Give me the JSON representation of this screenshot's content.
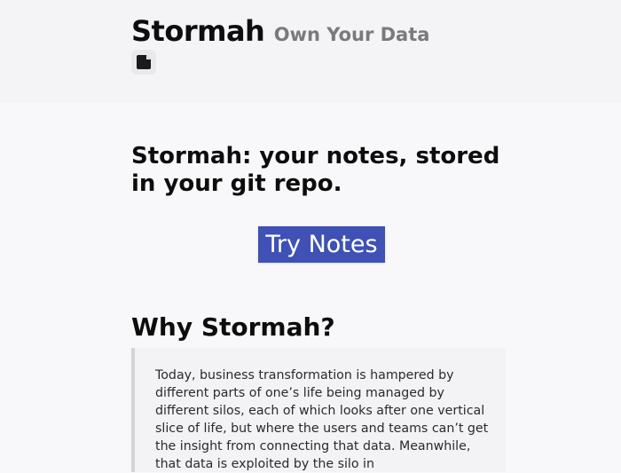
{
  "header": {
    "title": "Stormah",
    "tagline": "Own Your Data",
    "icon": "note-icon"
  },
  "hero": {
    "headline": "Stormah: your notes, stored in your git repo.",
    "cta_label": "Try Notes",
    "cta_color": "#3f51b5"
  },
  "why": {
    "heading": "Why Stormah?",
    "paragraph": "Today, business transformation is hampered by different parts of one’s life being managed by different silos, each of which looks after one vertical slice of life, but where the users and teams can’t get the insight from connecting that data. Meanwhile, that data is exploited by the silo in"
  }
}
